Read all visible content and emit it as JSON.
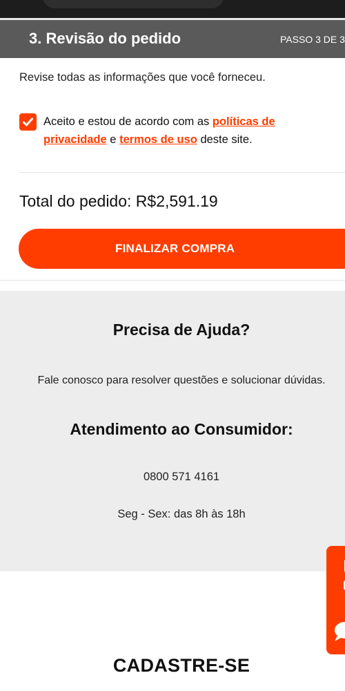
{
  "header": {
    "title": "3. Revisão do pedido",
    "step": "PASSO 3 DE 3"
  },
  "review": {
    "instructions": "Revise todas as informações que você forneceu.",
    "consent": {
      "checked": true,
      "text_before": "Aceito e estou de acordo com as ",
      "privacy_link": "políticas de privacidade",
      "connector": " e ",
      "terms_link": "termos de uso",
      "text_after": " deste site."
    },
    "total": "Total do pedido: R$2,591.19",
    "finalize_label": "FINALIZAR COMPRA"
  },
  "help": {
    "title": "Precisa de Ajuda?",
    "text": "Fale conosco para resolver questões e solucionar dúvidas.",
    "service_title": "Atendimento ao Consumidor:",
    "phone": "0800 571 4161",
    "hours": "Seg - Sex: das 8h às 18h"
  },
  "footer": {
    "signup": "CADASTRE-SE"
  },
  "chat_tab": {
    "icon": "chat-bubble-icon"
  },
  "colors": {
    "accent": "#ff3d00",
    "header_bg": "#5a5a5a",
    "help_bg": "#ededed"
  }
}
